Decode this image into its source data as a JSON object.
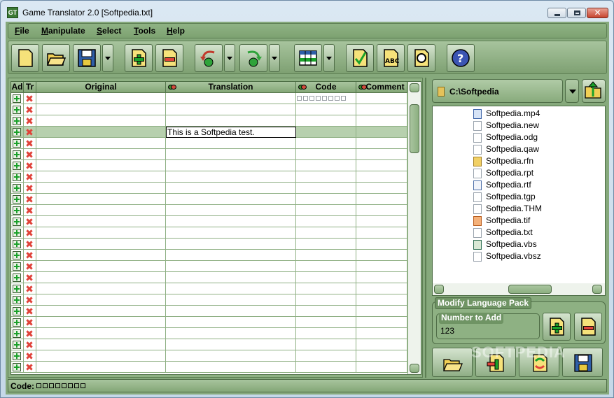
{
  "window": {
    "title": "Game Translator 2.0 [Softpedia.txt]",
    "app_icon": "GT",
    "close_glyph": "✕"
  },
  "menu": {
    "items": [
      {
        "label_first": "F",
        "label_rest": "ile"
      },
      {
        "label_first": "M",
        "label_rest": "anipulate"
      },
      {
        "label_first": "S",
        "label_rest": "elect"
      },
      {
        "label_first": "T",
        "label_rest": "ools"
      },
      {
        "label_first": "H",
        "label_rest": "elp"
      }
    ]
  },
  "toolbar": {
    "icons": [
      "new-file-icon",
      "open-folder-icon",
      "save-disk-icon",
      "add-row-icon",
      "remove-row-icon",
      "undo-gear-icon",
      "redo-gear-icon",
      "grid-table-icon",
      "check-document-icon",
      "spell-check-icon",
      "find-document-icon",
      "help-icon"
    ]
  },
  "grid": {
    "columns": {
      "add": "Ad",
      "tr": "Tr",
      "original": "Original",
      "translation": "Translation",
      "code": "Code",
      "comment": "Comment"
    },
    "row_count": 25,
    "selected_row": 3,
    "rows": {
      "r3": {
        "translation": "This is a Softpedia test."
      }
    },
    "first_row_code_boxes": 8
  },
  "files": {
    "drive": "C:\\Softpedia",
    "items": [
      {
        "name": "Softpedia.mp4",
        "icon": "video-file-icon"
      },
      {
        "name": "Softpedia.new",
        "icon": "blank-file-icon"
      },
      {
        "name": "Softpedia.odg",
        "icon": "blank-file-icon"
      },
      {
        "name": "Softpedia.qaw",
        "icon": "blank-file-icon"
      },
      {
        "name": "Softpedia.rfn",
        "icon": "folder-file-icon"
      },
      {
        "name": "Softpedia.rpt",
        "icon": "blank-file-icon"
      },
      {
        "name": "Softpedia.rtf",
        "icon": "document-file-icon"
      },
      {
        "name": "Softpedia.tgp",
        "icon": "blank-file-icon"
      },
      {
        "name": "Softpedia.THM",
        "icon": "blank-file-icon"
      },
      {
        "name": "Softpedia.tif",
        "icon": "image-file-icon"
      },
      {
        "name": "Softpedia.txt",
        "icon": "text-file-icon"
      },
      {
        "name": "Softpedia.vbs",
        "icon": "script-file-icon"
      },
      {
        "name": "Softpedia.vbsz",
        "icon": "blank-file-icon"
      }
    ]
  },
  "language_pack": {
    "title": "Modify Language Pack",
    "number_label": "Number to Add",
    "number_value": "123"
  },
  "status": {
    "code_label": "Code:",
    "code_boxes": 8
  },
  "watermark": "SOFTPEDIA",
  "colors": {
    "panel_green": "#86a97c",
    "selected_row": "#b7d0ae",
    "add_plus": "#1aa12a",
    "remove_x": "#e0433a"
  }
}
